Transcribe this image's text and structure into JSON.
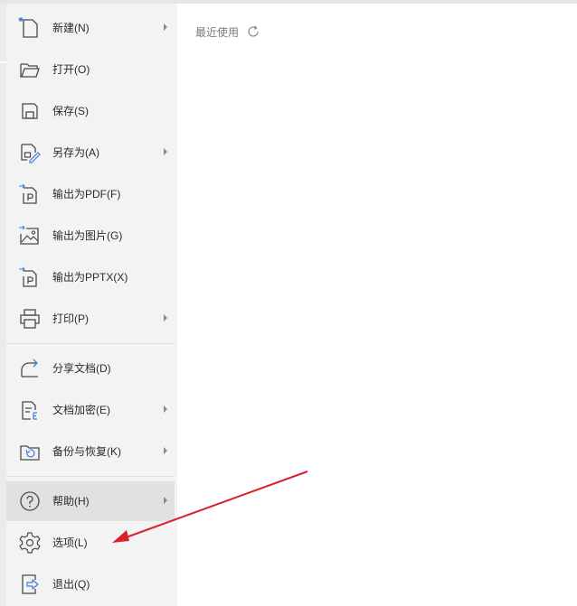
{
  "menu": {
    "items": [
      {
        "label": "新建(N)",
        "icon": "new-file-icon",
        "submenu": true
      },
      {
        "label": "打开(O)",
        "icon": "folder-open-icon",
        "submenu": false
      },
      {
        "label": "保存(S)",
        "icon": "save-icon",
        "submenu": false
      },
      {
        "label": "另存为(A)",
        "icon": "save-as-icon",
        "submenu": true
      },
      {
        "label": "输出为PDF(F)",
        "icon": "export-pdf-icon",
        "submenu": false
      },
      {
        "label": "输出为图片(G)",
        "icon": "export-image-icon",
        "submenu": false
      },
      {
        "label": "输出为PPTX(X)",
        "icon": "export-pptx-icon",
        "submenu": false
      },
      {
        "label": "打印(P)",
        "icon": "printer-icon",
        "submenu": true
      },
      {
        "label": "分享文档(D)",
        "icon": "share-icon",
        "submenu": false
      },
      {
        "label": "文档加密(E)",
        "icon": "encrypt-document-icon",
        "submenu": true
      },
      {
        "label": "备份与恢复(K)",
        "icon": "backup-restore-icon",
        "submenu": true
      },
      {
        "label": "帮助(H)",
        "icon": "help-icon",
        "submenu": true,
        "highlighted": true
      },
      {
        "label": "选项(L)",
        "icon": "gear-icon",
        "submenu": false
      },
      {
        "label": "退出(Q)",
        "icon": "exit-icon",
        "submenu": false
      }
    ]
  },
  "recent": {
    "title": "最近使用",
    "refresh_icon": "refresh-icon"
  },
  "annotation": {
    "arrow_color": "#d9232b"
  },
  "colors": {
    "menu_bg": "#f3f3f3",
    "hover_bg": "#e1e1e1",
    "icon_stroke": "#4a4a4a",
    "accent_blue": "#3d7fd9"
  }
}
